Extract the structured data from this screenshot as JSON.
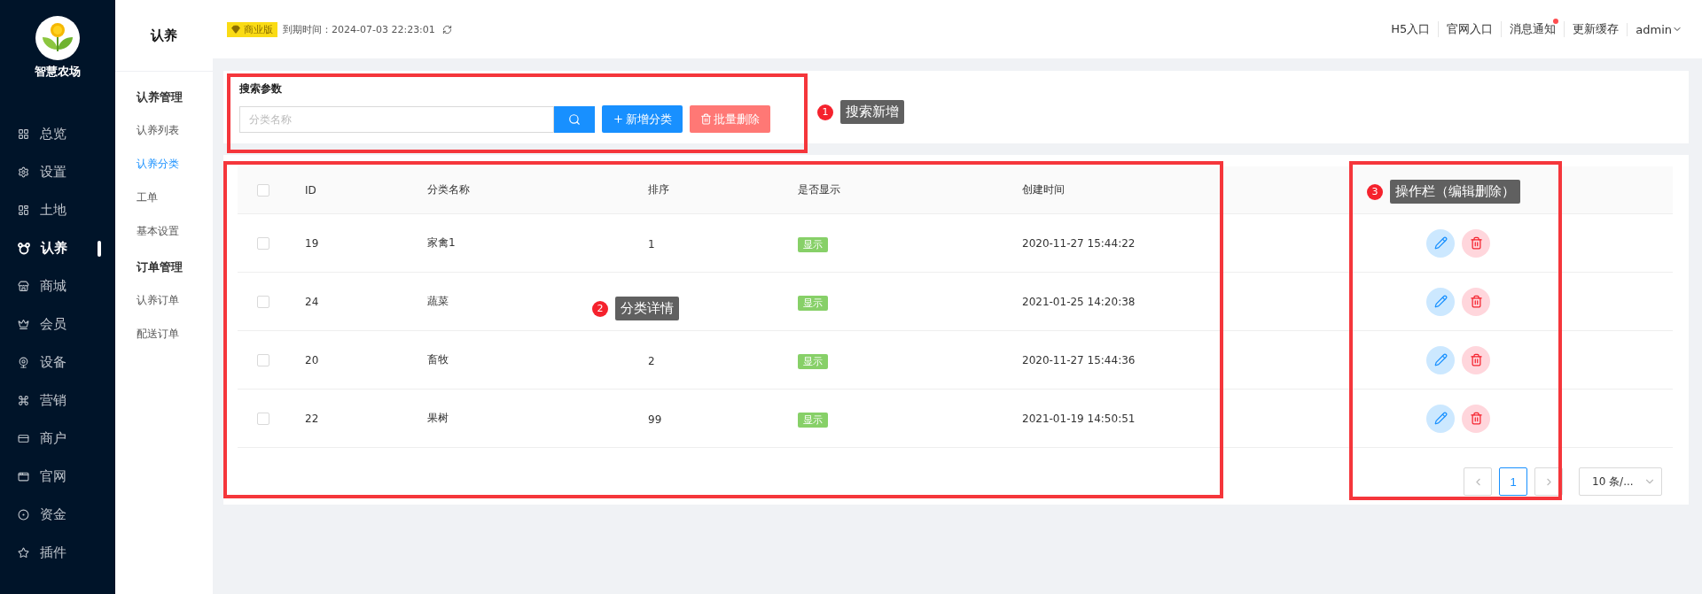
{
  "sidebar": {
    "logo_text": "智慧农场",
    "items": [
      {
        "label": "总览",
        "selected": false
      },
      {
        "label": "设置",
        "selected": false
      },
      {
        "label": "土地",
        "selected": false
      },
      {
        "label": "认养",
        "selected": true
      },
      {
        "label": "商城",
        "selected": false
      },
      {
        "label": "会员",
        "selected": false
      },
      {
        "label": "设备",
        "selected": false
      },
      {
        "label": "营销",
        "selected": false
      },
      {
        "label": "商户",
        "selected": false
      },
      {
        "label": "官网",
        "selected": false
      },
      {
        "label": "资金",
        "selected": false
      },
      {
        "label": "插件",
        "selected": false
      }
    ]
  },
  "submenu": {
    "title": "认养",
    "groups": [
      {
        "heading": "认养管理",
        "items": [
          {
            "label": "认养列表",
            "selected": false
          },
          {
            "label": "认养分类",
            "selected": true
          },
          {
            "label": "工单",
            "selected": false
          },
          {
            "label": "基本设置",
            "selected": false
          }
        ]
      },
      {
        "heading": "订单管理",
        "items": [
          {
            "label": "认养订单",
            "selected": false
          },
          {
            "label": "配送订单",
            "selected": false
          }
        ]
      }
    ]
  },
  "header": {
    "edition": "商业版",
    "expiry": "到期时间：2024-07-03 22:23:01",
    "links": [
      {
        "label": "H5入口",
        "unread": false
      },
      {
        "label": "官网入口",
        "unread": false
      },
      {
        "label": "消息通知",
        "unread": true
      },
      {
        "label": "更新缓存",
        "unread": false
      }
    ],
    "user": "admin"
  },
  "search": {
    "title": "搜索参数",
    "placeholder": "分类名称",
    "buttons": [
      {
        "kind": "add",
        "label": "新增分类"
      },
      {
        "kind": "delete",
        "label": "批量删除"
      }
    ]
  },
  "table": {
    "columns": [
      "ID",
      "分类名称",
      "排序",
      "是否显示",
      "创建时间"
    ],
    "header_checked": false,
    "rows": [
      {
        "checked": false,
        "id": "19",
        "name": "家禽1",
        "sort": "1",
        "visible": "显示",
        "created": "2020-11-27 15:44:22"
      },
      {
        "checked": false,
        "id": "24",
        "name": "蔬菜",
        "visible": "显示",
        "created": "2021-01-25 14:20:38"
      },
      {
        "checked": false,
        "id": "20",
        "name": "畜牧",
        "sort": "2",
        "visible": "显示",
        "created": "2020-11-27 15:44:36"
      },
      {
        "checked": false,
        "id": "22",
        "name": "果树",
        "sort": "99",
        "visible": "显示",
        "created": "2021-01-19 14:50:51"
      }
    ]
  },
  "pagination": {
    "pages": [
      {
        "label": "1",
        "selected": true
      }
    ],
    "page_size": "10 条/..."
  },
  "annotations": [
    {
      "number": "1",
      "label": "搜索新增"
    },
    {
      "number": "2",
      "label": "分类详情"
    },
    {
      "number": "3",
      "label": "操作栏（编辑删除）"
    }
  ]
}
